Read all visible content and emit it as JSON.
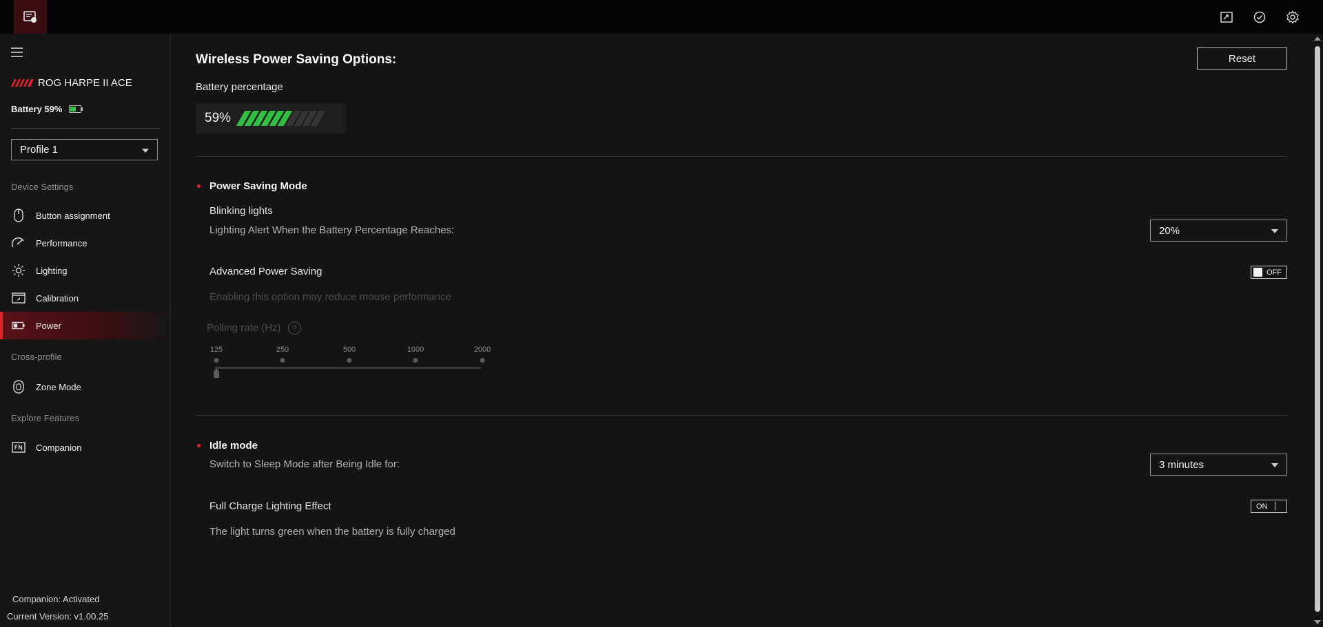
{
  "device": {
    "name": "ROG HARPE II ACE",
    "battery_label": "Battery 59%",
    "battery_level": 0.59
  },
  "profile": {
    "selected": "Profile 1"
  },
  "sidebar": {
    "device_settings_label": "Device Settings",
    "items": [
      {
        "label": "Button assignment",
        "icon": "mouse-icon"
      },
      {
        "label": "Performance",
        "icon": "performance-icon"
      },
      {
        "label": "Lighting",
        "icon": "lighting-icon"
      },
      {
        "label": "Calibration",
        "icon": "calibration-icon"
      },
      {
        "label": "Power",
        "icon": "battery-icon",
        "active": true
      }
    ],
    "cross_profile_label": "Cross-profile",
    "cross_items": [
      {
        "label": "Zone Mode",
        "icon": "zone-mode-icon"
      }
    ],
    "explore_label": "Explore Features",
    "explore_items": [
      {
        "label": "Companion",
        "icon": "companion-icon"
      }
    ],
    "companion_status": "Companion: Activated",
    "version": "Current Version: v1.00.25"
  },
  "main": {
    "title": "Wireless Power Saving Options:",
    "reset_label": "Reset",
    "battery_percentage_label": "Battery percentage",
    "battery_percent_text": "59%",
    "battery_segments_on": 6,
    "battery_segments_total": 10,
    "power_saving": {
      "title": "Power Saving Mode",
      "blinking_lights": "Blinking lights",
      "lighting_alert_label": "Lighting Alert When the Battery Percentage Reaches:",
      "lighting_alert_value": "20%",
      "advanced_label": "Advanced Power Saving",
      "advanced_toggle": "OFF",
      "advanced_note": "Enabling this option may reduce mouse performance",
      "polling_label": "Polling rate (Hz)",
      "polling_help": "?",
      "polling_values": [
        "125",
        "250",
        "500",
        "1000",
        "2000"
      ],
      "polling_selected": "125"
    },
    "idle": {
      "title": "Idle mode",
      "sleep_label": "Switch to Sleep Mode after Being Idle for:",
      "sleep_value": "3 minutes",
      "full_charge_label": "Full Charge Lighting Effect",
      "full_charge_toggle": "ON",
      "full_charge_note": "The light turns green when the battery is fully charged"
    }
  },
  "colors": {
    "accent": "#e0232c",
    "battery_green": "#31c043",
    "background": "#141414"
  }
}
